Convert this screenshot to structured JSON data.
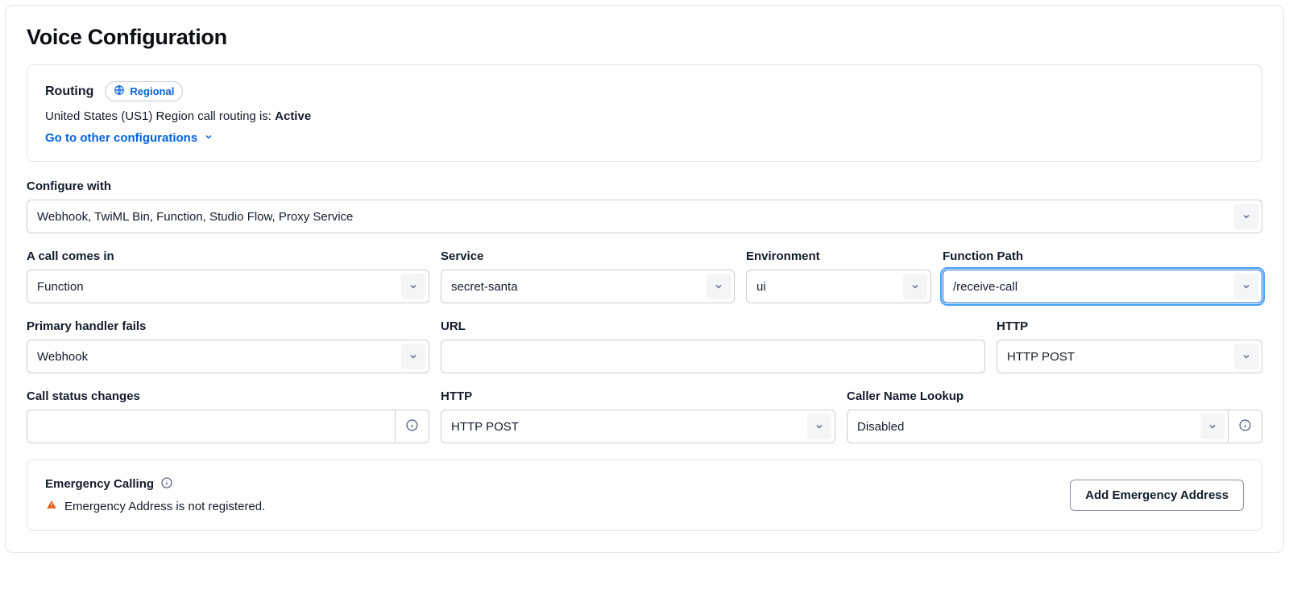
{
  "title": "Voice Configuration",
  "routing": {
    "label": "Routing",
    "regional_label": "Regional",
    "status_prefix": "United States (US1) Region call routing is: ",
    "status_value": "Active",
    "other_link": "Go to other configurations"
  },
  "configure_with": {
    "label": "Configure with",
    "value": "Webhook, TwiML Bin, Function, Studio Flow, Proxy Service"
  },
  "call_comes_in": {
    "label": "A call comes in",
    "value": "Function"
  },
  "service": {
    "label": "Service",
    "value": "secret-santa"
  },
  "environment": {
    "label": "Environment",
    "value": "ui"
  },
  "function_path": {
    "label": "Function Path",
    "value": "/receive-call"
  },
  "primary_fails": {
    "label": "Primary handler fails",
    "value": "Webhook"
  },
  "url": {
    "label": "URL",
    "value": ""
  },
  "http1": {
    "label": "HTTP",
    "value": "HTTP POST"
  },
  "call_status": {
    "label": "Call status changes",
    "value": ""
  },
  "http2": {
    "label": "HTTP",
    "value": "HTTP POST"
  },
  "caller_lookup": {
    "label": "Caller Name Lookup",
    "value": "Disabled"
  },
  "emergency": {
    "title": "Emergency Calling",
    "status": "Emergency Address is not registered.",
    "button": "Add Emergency Address"
  }
}
